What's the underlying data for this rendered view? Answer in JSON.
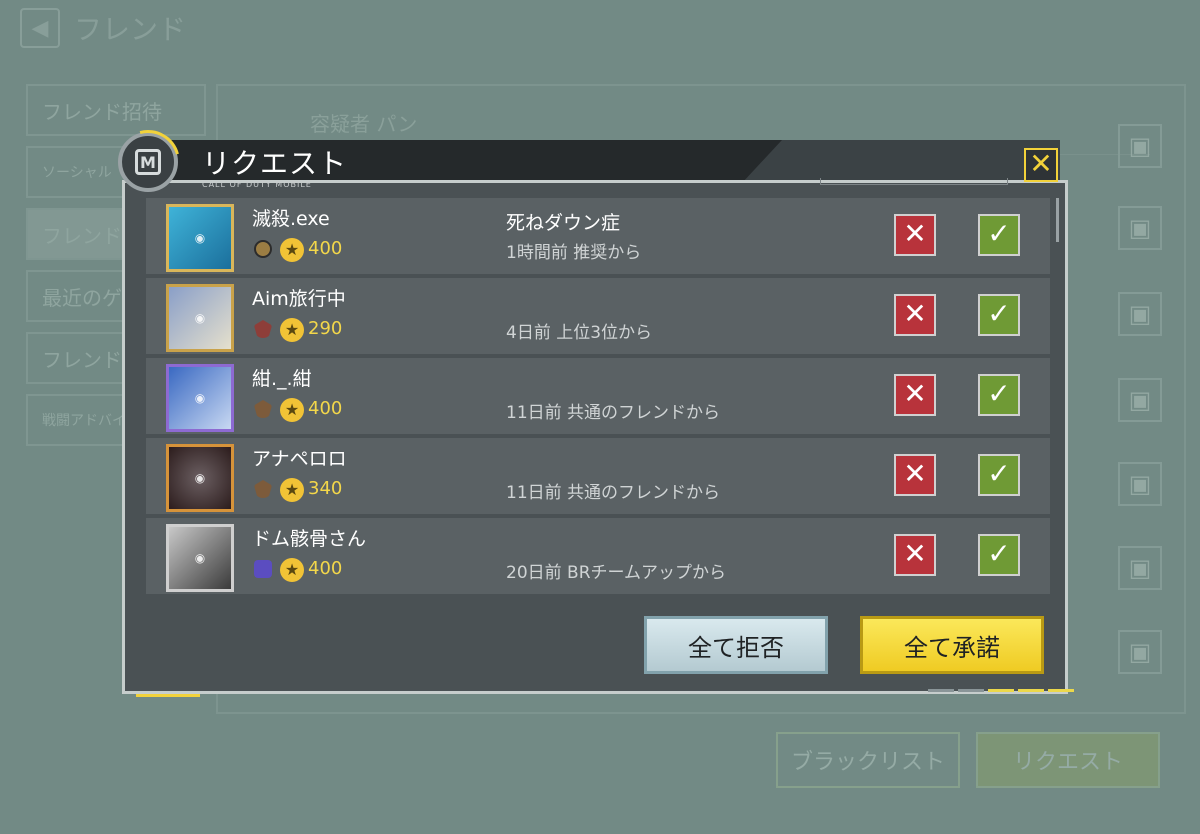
{
  "background": {
    "back_icon": "back-arrow-icon",
    "title": "フレンド",
    "sidebar": [
      {
        "label": "フレンド招待"
      },
      {
        "label": "ソーシャル"
      },
      {
        "label": "フレンド"
      },
      {
        "label": "最近のゲ"
      },
      {
        "label": "フレンド"
      },
      {
        "label": "戦闘アドバイ"
      }
    ],
    "first_row_name": "容疑者 パン",
    "blacklist_label": "ブラックリスト",
    "request_label": "リクエスト"
  },
  "modal": {
    "title": "リクエスト",
    "subtitle": "CALL OF DUTY MOBILE",
    "close_icon": "close-icon",
    "requests": [
      {
        "name": "滅殺.exe",
        "points": "400",
        "title": "死ねダウン症",
        "subtitle": "1時間前 推奨から"
      },
      {
        "name": "Aim旅行中",
        "points": "290",
        "title": "",
        "subtitle": "4日前 上位3位から"
      },
      {
        "name": "紺._.紺",
        "points": "400",
        "title": "",
        "subtitle": "11日前 共通のフレンドから"
      },
      {
        "name": "アナペロロ",
        "points": "340",
        "title": "",
        "subtitle": "11日前 共通のフレンドから"
      },
      {
        "name": "ドム骸骨さん",
        "points": "400",
        "title": "",
        "subtitle": "20日前 BRチームアップから"
      }
    ],
    "reject_glyph": "✕",
    "accept_glyph": "✓",
    "star_glyph": "★",
    "reject_all": "全て拒否",
    "accept_all": "全て承諾"
  },
  "colors": {
    "accent_yellow": "#f2d23a",
    "reject_red": "#b8333b",
    "accept_green": "#6f9a35",
    "points_gold": "#f3d74a"
  }
}
